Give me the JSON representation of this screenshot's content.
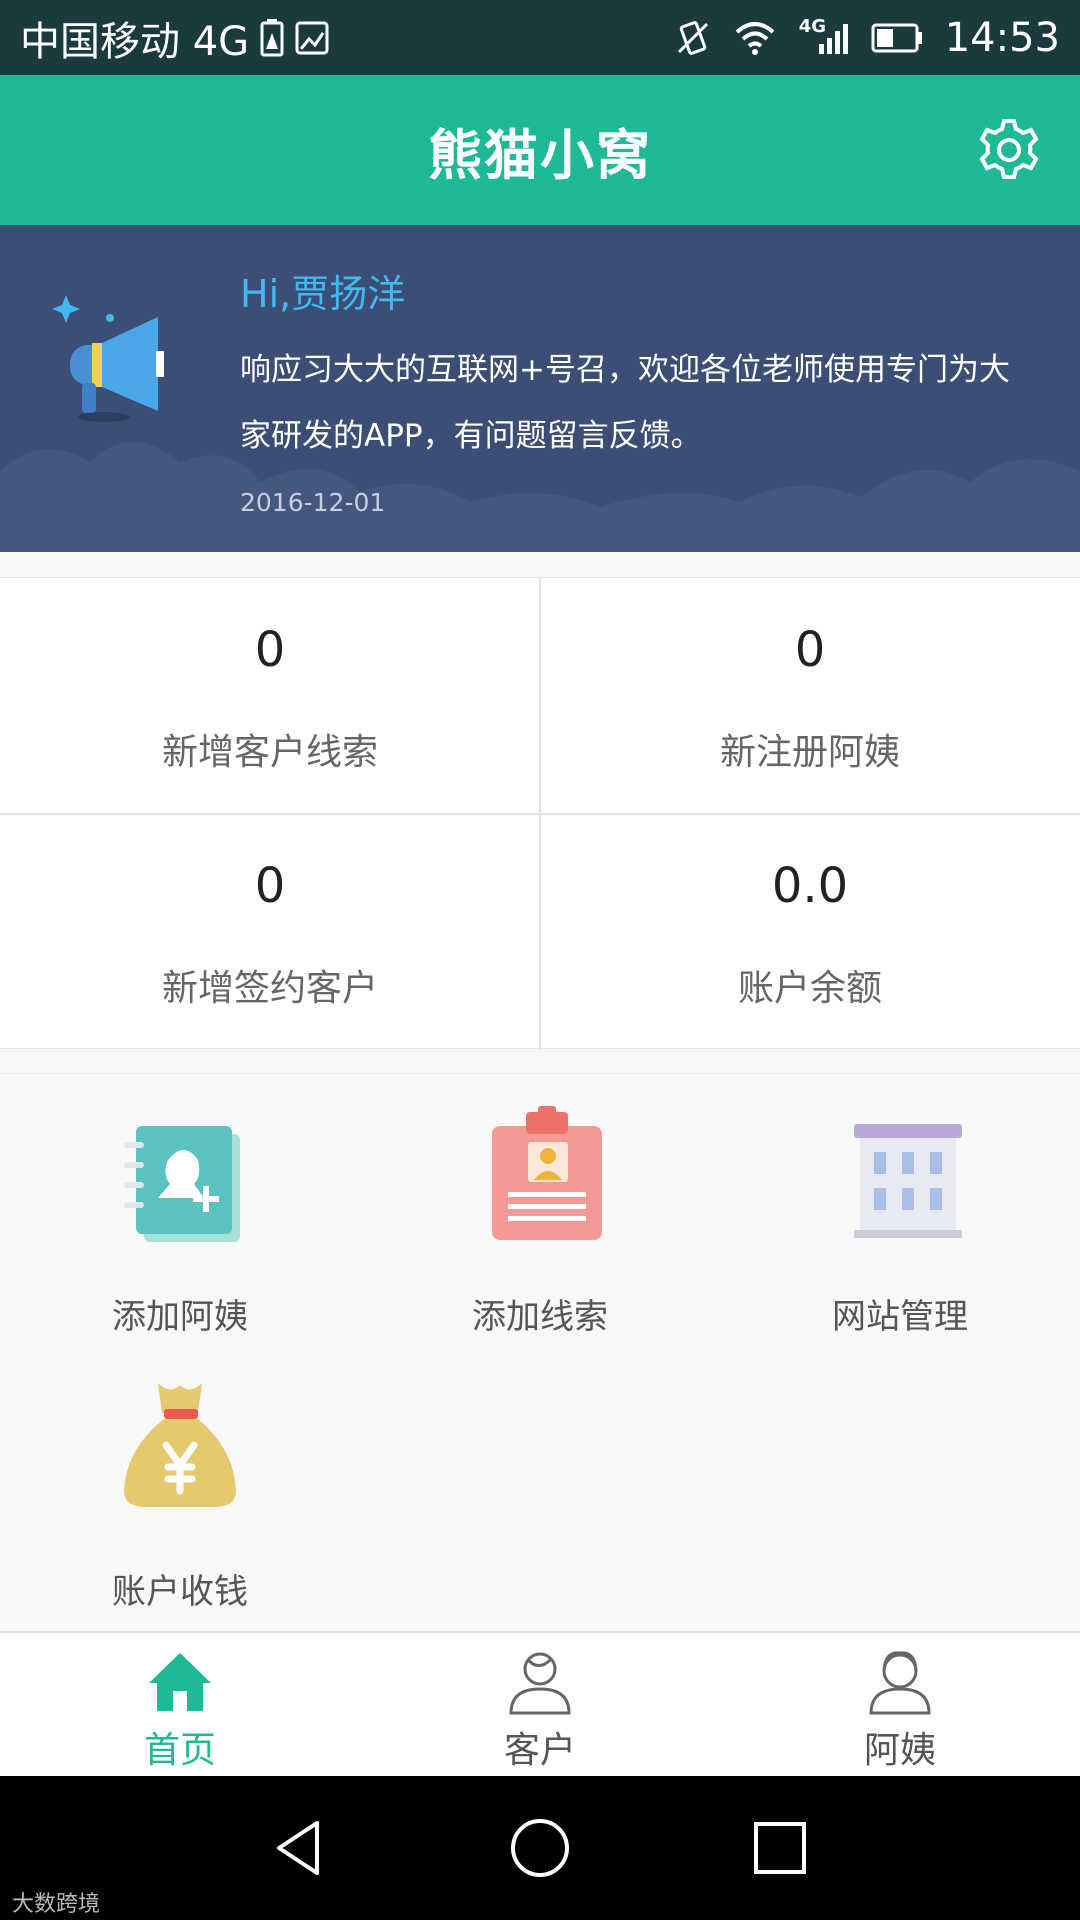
{
  "status_bar": {
    "carrier": "中国移动 4G",
    "network": "4G",
    "time": "14:53"
  },
  "header": {
    "title": "熊猫小窝",
    "settings_icon": "gear-icon"
  },
  "notice": {
    "greeting": "Hi,贾扬洋",
    "message": "响应习大大的互联网+号召，欢迎各位老师使用专门为大家研发的APP，有问题留言反馈。",
    "date": "2016-12-01"
  },
  "stats": [
    {
      "value": "0",
      "label": "新增客户线索"
    },
    {
      "value": "0",
      "label": "新注册阿姨"
    },
    {
      "value": "0",
      "label": "新增签约客户"
    },
    {
      "value": "0.0",
      "label": "账户余额"
    }
  ],
  "actions": [
    {
      "label": "添加阿姨",
      "icon": "add-contact-book-icon"
    },
    {
      "label": "添加线索",
      "icon": "clipboard-badge-icon"
    },
    {
      "label": "网站管理",
      "icon": "building-icon"
    },
    {
      "label": "账户收钱",
      "icon": "money-bag-icon"
    }
  ],
  "tabs": [
    {
      "label": "首页",
      "icon": "home-icon",
      "active": true
    },
    {
      "label": "客户",
      "icon": "customer-icon",
      "active": false
    },
    {
      "label": "阿姨",
      "icon": "nanny-icon",
      "active": false
    }
  ],
  "watermark": "大数跨境",
  "colors": {
    "accent": "#1eb996",
    "banner": "#3c4e75",
    "greeting": "#41b8ef"
  }
}
